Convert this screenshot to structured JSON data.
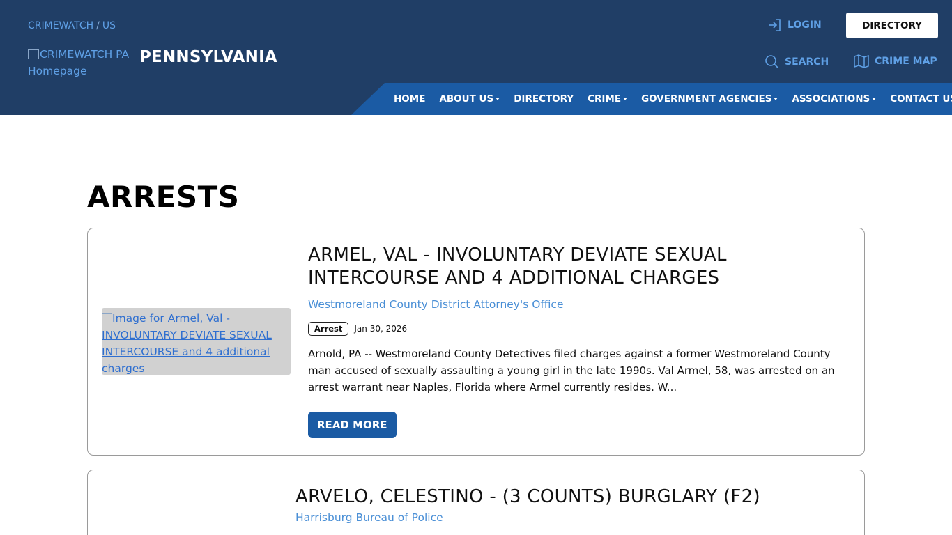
{
  "header": {
    "breadcrumb": [
      "CRIMEWATCH",
      "US"
    ],
    "logo_alt": "CRIMEWATCH PA Homepage",
    "state_title": "PENNSYLVANIA",
    "login_label": "LOGIN",
    "directory_button": "DIRECTORY",
    "search_label": "SEARCH",
    "crime_map_label": "CRIME MAP",
    "colors": {
      "header_bg": "#203e66",
      "nav_bg": "#1b5ba4",
      "link": "#5fa0e6"
    }
  },
  "nav": [
    {
      "label": "HOME",
      "dropdown": false
    },
    {
      "label": "ABOUT US",
      "dropdown": true
    },
    {
      "label": "DIRECTORY",
      "dropdown": false
    },
    {
      "label": "CRIME",
      "dropdown": true
    },
    {
      "label": "GOVERNMENT AGENCIES",
      "dropdown": true
    },
    {
      "label": "ASSOCIATIONS",
      "dropdown": true
    },
    {
      "label": "CONTACT US",
      "dropdown": false
    }
  ],
  "main": {
    "page_title": "ARRESTS",
    "cards": [
      {
        "image_alt": "Image for Armel, Val - INVOLUNTARY DEVIATE SEXUAL INTERCOURSE and 4 additional charges",
        "title": "ARMEL, VAL - INVOLUNTARY DEVIATE SEXUAL INTERCOURSE AND 4 ADDITIONAL CHARGES",
        "agency": "Westmoreland County District Attorney's Office",
        "badge": "Arrest",
        "date": "Jan 30, 2026",
        "excerpt": "Arnold, PA -- Westmoreland County Detectives filed charges against a former Westmoreland County man accused of sexually assaulting a young girl in the late 1990s.  Val Armel, 58, was arrested on an arrest warrant near Naples, Florida where Armel currently resides.  W...",
        "read_more": "READ MORE"
      },
      {
        "title": "ARVELO, CELESTINO - (3 COUNTS) BURGLARY (F2)",
        "agency": "Harrisburg Bureau of Police"
      }
    ]
  }
}
